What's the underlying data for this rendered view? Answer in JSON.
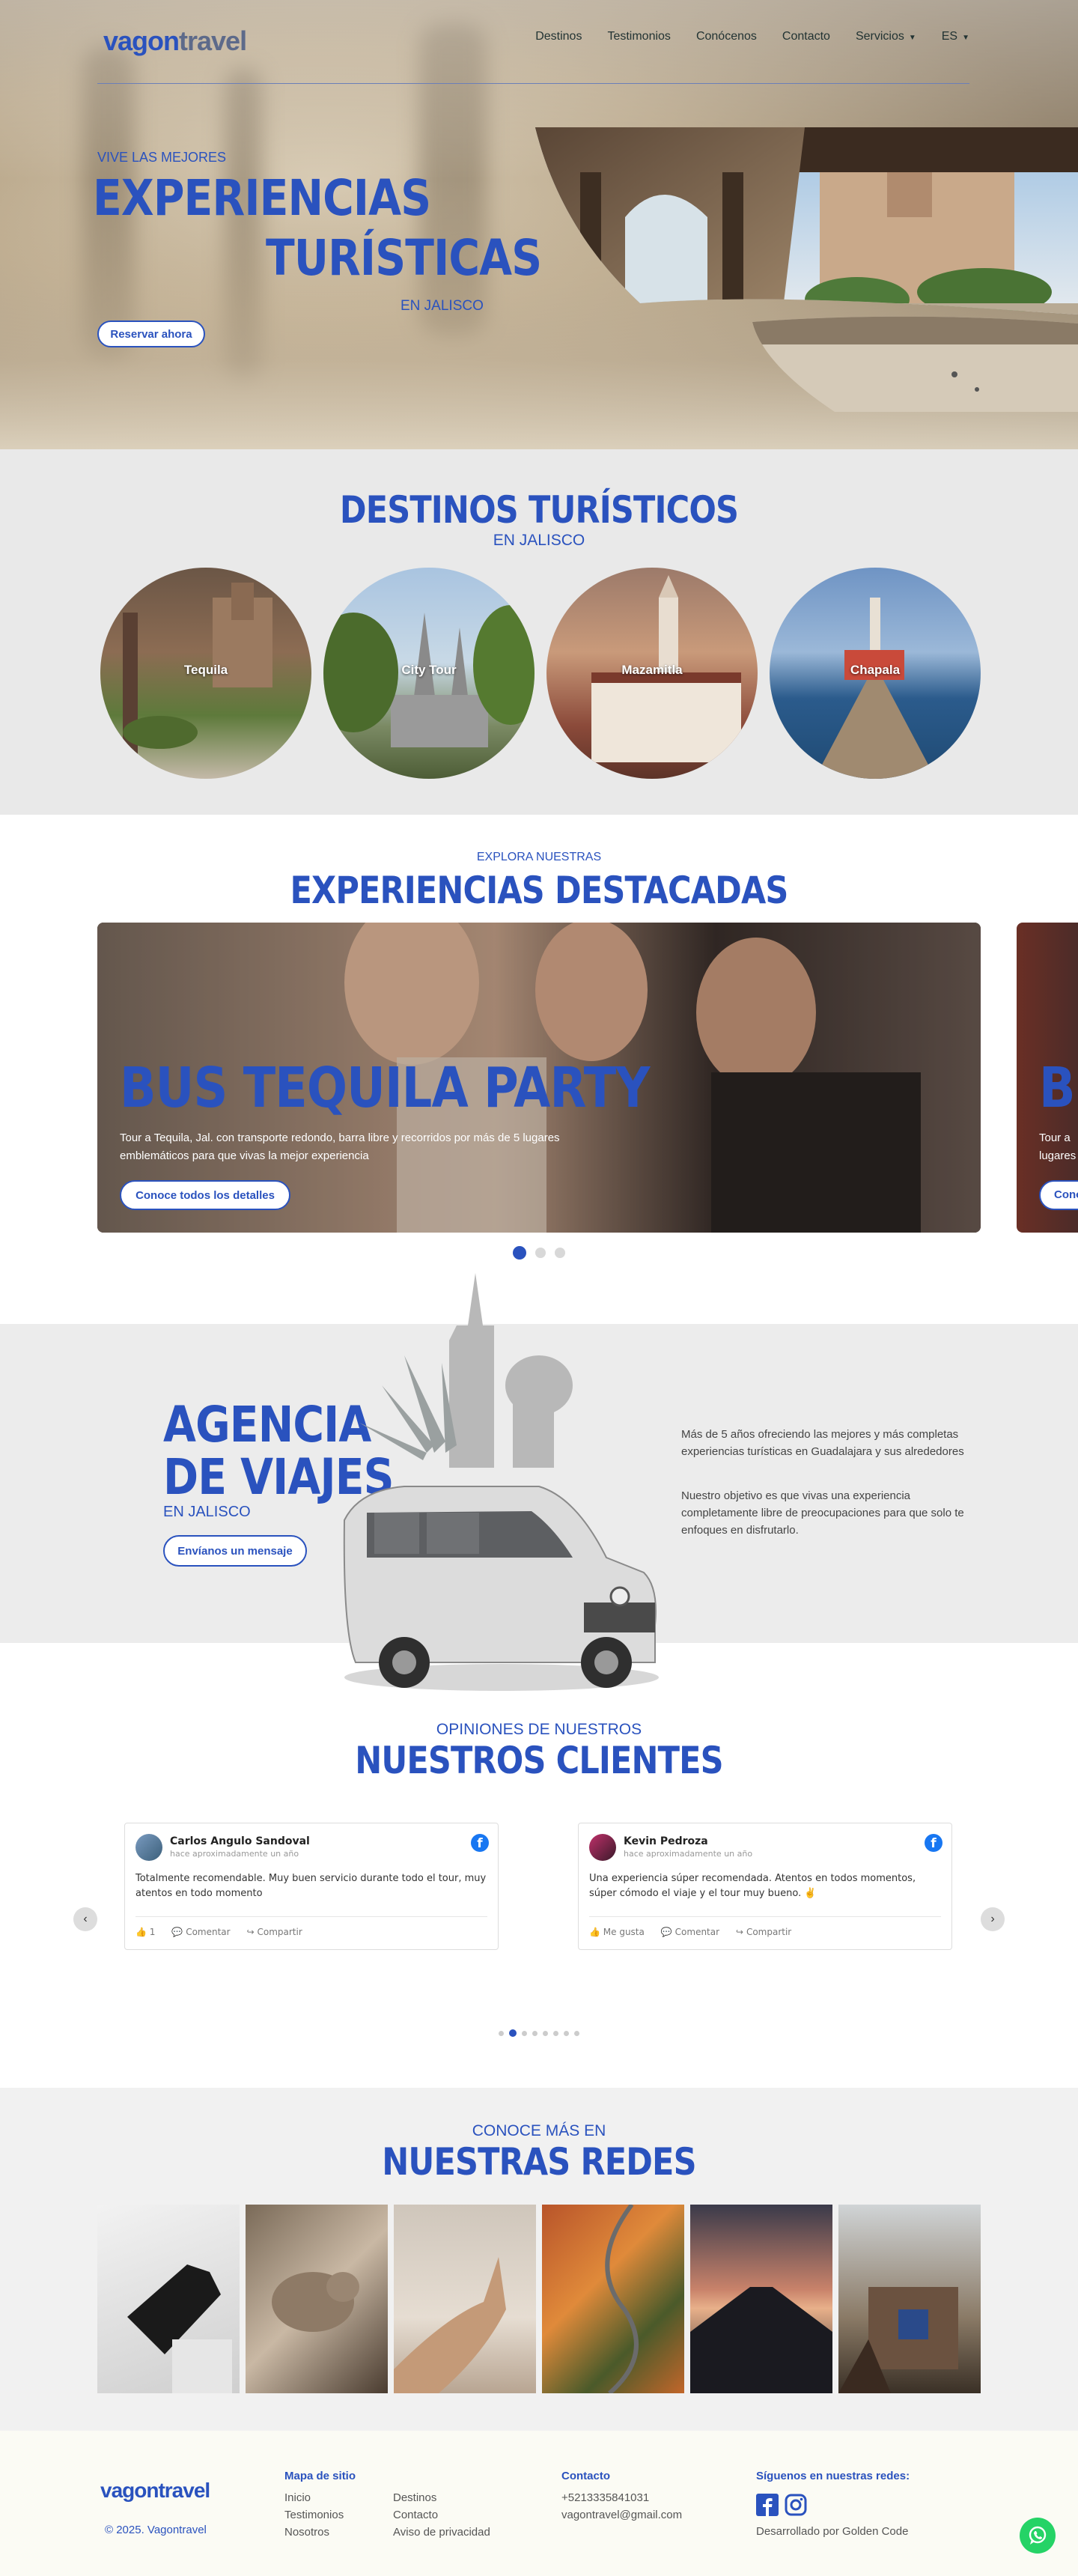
{
  "header": {
    "logo_a": "vagon",
    "logo_b": "travel",
    "nav": [
      "Destinos",
      "Testimonios",
      "Conócenos",
      "Contacto",
      "Servicios",
      "ES"
    ]
  },
  "hero": {
    "kicker": "VIVE LAS MEJORES",
    "title_1": "EXPERIENCIAS",
    "title_2": "TURÍSTICAS",
    "subtitle": "EN JALISCO",
    "button": "Reservar ahora"
  },
  "destinos": {
    "title": "DESTINOS TURÍSTICOS",
    "subtitle": "EN JALISCO",
    "items": [
      "Tequila",
      "City Tour",
      "Mazamitla",
      "Chapala"
    ]
  },
  "experiencias": {
    "kicker": "EXPLORA NUESTRAS",
    "title": "EXPERIENCIAS DESTACADAS",
    "slide_title": "BUS TEQUILA PARTY",
    "slide_desc": "Tour a Tequila, Jal. con transporte redondo, barra libre y recorridos por más de 5 lugares emblemáticos para que vivas la mejor experiencia",
    "slide_button": "Conoce todos los detalles",
    "next_title": "BU",
    "next_desc_1": "Tour a",
    "next_desc_2": "lugares",
    "next_button": "Conoc"
  },
  "agencia": {
    "title_1": "AGENCIA",
    "title_2": "DE VIAJES",
    "subtitle": "EN JALISCO",
    "button": "Envíanos un mensaje",
    "p1": "Más de 5 años ofreciendo las mejores y más completas experiencias turísticas en Guadalajara y sus alrededores",
    "p2": "Nuestro objetivo es que vivas una experiencia completamente libre de preocupaciones para que solo te enfoques en disfrutarlo."
  },
  "opiniones": {
    "kicker": "OPINIONES DE NUESTROS",
    "title": "NUESTROS CLIENTES",
    "reviews": [
      {
        "name": "Carlos Angulo Sandoval",
        "time": "hace aproximadamente un año",
        "text": "Totalmente recomendable. Muy buen servicio durante todo el tour, muy atentos en todo momento",
        "like": "1",
        "comment": "Comentar",
        "share": "Compartir"
      },
      {
        "name": "Kevin Pedroza",
        "time": "hace aproximadamente un año",
        "text": "Una experiencia súper recomendada. Atentos en todos momentos, súper cómodo el viaje y el tour muy bueno. ✌️",
        "like": "Me gusta",
        "comment": "Comentar",
        "share": "Compartir"
      }
    ]
  },
  "redes": {
    "kicker": "CONOCE MÁS EN",
    "title": "NUESTRAS REDES"
  },
  "footer": {
    "logo": "vagontravel",
    "copyright": "© 2025. Vagontravel",
    "mapa_title": "Mapa de sitio",
    "mapa_col1": [
      "Inicio",
      "Testimonios",
      "Nosotros"
    ],
    "mapa_col2": [
      "Destinos",
      "Contacto",
      "Aviso de privacidad"
    ],
    "contacto_title": "Contacto",
    "phone": "+5213335841031",
    "email": "vagontravel@gmail.com",
    "social_title": "Síguenos en nuestras redes:",
    "dev": "Desarrollado por Golden Code"
  },
  "colors": {
    "accent": "#2a52be",
    "whatsapp": "#25d366",
    "facebook": "#1877f2"
  }
}
